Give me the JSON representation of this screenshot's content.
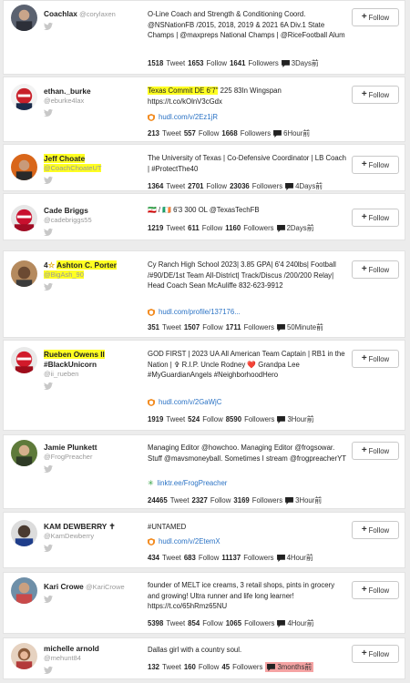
{
  "follow_label": "Follow",
  "plus_symbol": "+",
  "accent_color": "#2b73c5",
  "highlight_color": "#ffff22",
  "items": [
    {
      "name": "Coachlax",
      "handle": "@corylaxen",
      "bio": "O-Line Coach and Strength & Conditioning Coord. @NSNationFB /2015, 2018, 2019 & 2021 6A Div.1 State Champs | @maxpreps National Champs | @RiceFootball Alum",
      "tweets": "1518",
      "following": "1653",
      "followers": "1641",
      "time": "3Days前"
    },
    {
      "name": "ethan._burke",
      "handle": "@eburke4lax",
      "bio_highlight": "Texas Commit DE 6'7\"",
      "bio": " 225 83In Wingspan https://t.co/kOlnV3cGdx",
      "link": "hudl.com/v/2Ez1jR",
      "tweets": "213",
      "following": "557",
      "followers": "1668",
      "time": "6Hour前"
    },
    {
      "name": "Jeff Choate",
      "handle": "@CoachChoateUT",
      "bio": "The University of Texas | Co-Defensive Coordinator | LB Coach | #ProtectThe40",
      "tweets": "1364",
      "following": "2701",
      "followers": "23036",
      "time": "4Days前"
    },
    {
      "name": "Cade Briggs",
      "handle": "@cadebriggs55",
      "bio": "🇮🇷 / 🇮🇪 6'3 300 OL @TexasTechFB",
      "tweets": "1219",
      "following": "611",
      "followers": "1160",
      "time": "2Days前"
    },
    {
      "name_prefix": "4",
      "name": "Ashton C. Porter",
      "handle": "@BigAsh_90",
      "bio": "Cy Ranch High School 2023| 3.85 GPA| 6'4 240lbs| Football /#90/DE/1st Team All-District| Track/Discus /200/200 Relay| Head Coach Sean McAuliffe 832-623-9912",
      "link": "hudl.com/profile/137176...",
      "tweets": "351",
      "following": "1507",
      "followers": "1711",
      "time": "50Minute前"
    },
    {
      "name": "Rueben Owens II",
      "name2": "#BlackUnicorn",
      "handle": "@ii_rueben",
      "bio": "GOD FIRST | 2023 UA All American Team Captain | RB1 in the Nation | ✞ R.I.P. Uncle Rodney ❤️ Grandpa Lee #MyGuardianAngels #NeighborhoodHero",
      "link": "hudl.com/v/2GaWjC",
      "tweets": "1919",
      "following": "524",
      "followers": "8590",
      "time": "3Hour前"
    },
    {
      "name": "Jamie Plunkett",
      "handle": "@FrogPreacher",
      "bio": "Managing Editor @howchoo. Managing Editor @frogsowar. Stuff @mavsmoneyball. Sometimes I stream @frogpreacherYT",
      "link": "linktr.ee/FrogPreacher",
      "tweets": "24465",
      "following": "2327",
      "followers": "3169",
      "time": "3Hour前"
    },
    {
      "name": "KAM DEWBERRY ✝",
      "handle": "@KamDewberry",
      "bio": "#UNTAMED",
      "link": "hudl.com/v/2EtemX",
      "tweets": "434",
      "following": "683",
      "followers": "11137",
      "time": "4Hour前"
    },
    {
      "name": "Kari Crowe",
      "handle": "@KariCrowe",
      "bio": "founder of MELT ice creams, 3 retail shops, pints in grocery and growing! Ultra runner and life long learner! https://t.co/65hRmz65NU",
      "tweets": "5398",
      "following": "854",
      "followers": "1065",
      "time": "4Hour前"
    },
    {
      "name": "michelle arnold",
      "handle": "@mehunt84",
      "bio": "Dallas girl with a country soul.",
      "tweets": "132",
      "following": "160",
      "followers": "45",
      "time": "3months前"
    }
  ],
  "labels": {
    "tweet": "Tweet",
    "follow": "Follow",
    "followers": "Followers"
  }
}
